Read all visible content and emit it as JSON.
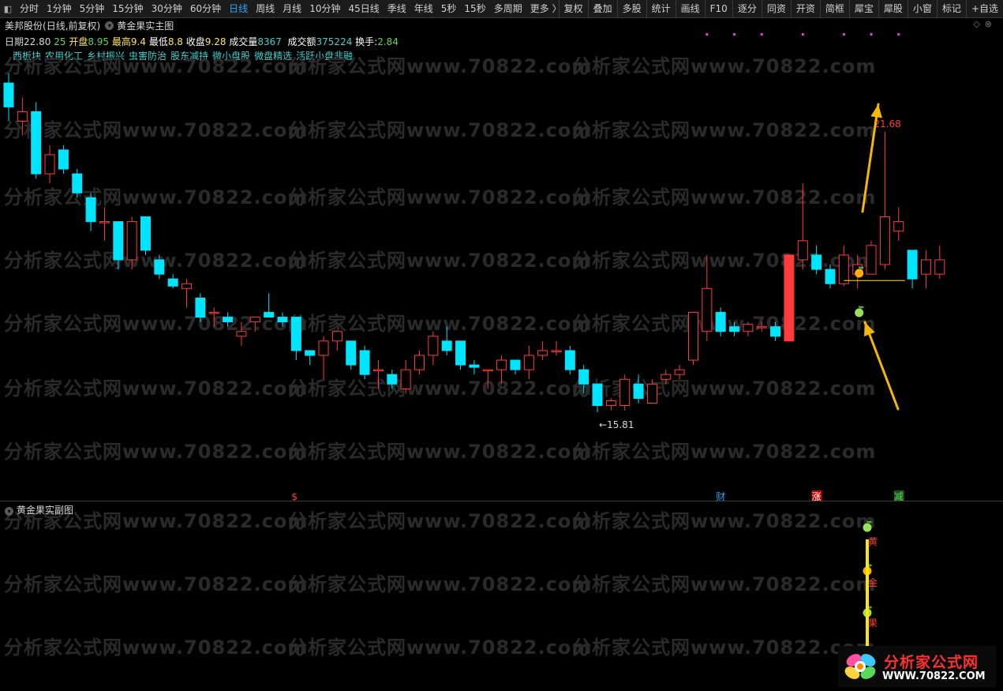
{
  "toolbar": {
    "periods": [
      "分时",
      "1分钟",
      "5分钟",
      "15分钟",
      "30分钟",
      "60分钟",
      "日线",
      "周线",
      "月线",
      "10分钟",
      "45日线",
      "季线",
      "年线",
      "5秒",
      "15秒",
      "多周期",
      "更多 〉"
    ],
    "active_period": "日线",
    "right_buttons": [
      "复权",
      "叠加",
      "多股",
      "统计",
      "画线",
      "F10",
      "逐分",
      "同资",
      "开资",
      "简框",
      "犀宝",
      "犀股",
      "小窗",
      "标记",
      "+自选"
    ]
  },
  "title_row": {
    "stock": "美邦股份",
    "mode": "(日线,前复权)",
    "indicator": "黄金果实主图"
  },
  "info_row": {
    "date_label": "日期",
    "date_value": "25",
    "open_label": "开盘",
    "open_value": "8.95",
    "high_label": "最高",
    "high_value": "9.4",
    "low_label": "最低",
    "low_value": "8.8",
    "close_label": "收盘",
    "close_value": "9.28",
    "vol_label": "成交量",
    "vol_value": "8367",
    "amount_label": "成交额",
    "amount_value": "375224",
    "turnover_label": "换手",
    "turnover_value": "2.84",
    "top_left_price": "22.80"
  },
  "concepts": [
    "西板块",
    "农用化工",
    "乡村振兴",
    "虫害防治",
    "股东减持",
    "微小盘股",
    "微盘精选",
    "活跃小盘非融"
  ],
  "sub_title": "黄金果实副图",
  "watermark": {
    "text": "分析家公式网www.70822.com"
  },
  "logo": {
    "title": "分析家公式网",
    "url": "WWW.70822.COM"
  },
  "colors": {
    "up": "#ff3b3b",
    "down": "#00e5ff",
    "arrow": "#f5b800",
    "yellow": "#ffe600",
    "bg": "#000000"
  },
  "chart_data": {
    "type": "candlestick",
    "y_axis": {
      "min": 15.0,
      "max": 23.0
    },
    "candles": [
      {
        "o": 22.7,
        "h": 22.9,
        "l": 21.9,
        "c": 22.2
      },
      {
        "o": 21.9,
        "h": 22.4,
        "l": 21.6,
        "c": 22.1
      },
      {
        "o": 22.1,
        "h": 22.3,
        "l": 20.7,
        "c": 20.8
      },
      {
        "o": 20.8,
        "h": 21.4,
        "l": 20.6,
        "c": 21.2
      },
      {
        "o": 21.3,
        "h": 21.4,
        "l": 20.8,
        "c": 20.9
      },
      {
        "o": 20.8,
        "h": 20.9,
        "l": 20.3,
        "c": 20.4
      },
      {
        "o": 20.3,
        "h": 20.4,
        "l": 19.6,
        "c": 19.8
      },
      {
        "o": 19.8,
        "h": 20.1,
        "l": 19.4,
        "c": 19.8
      },
      {
        "o": 19.8,
        "h": 19.8,
        "l": 18.8,
        "c": 19.0
      },
      {
        "o": 19.0,
        "h": 19.9,
        "l": 18.8,
        "c": 19.8
      },
      {
        "o": 19.9,
        "h": 19.9,
        "l": 19.1,
        "c": 19.2
      },
      {
        "o": 19.0,
        "h": 19.1,
        "l": 18.6,
        "c": 18.7
      },
      {
        "o": 18.6,
        "h": 18.7,
        "l": 18.4,
        "c": 18.45
      },
      {
        "o": 18.4,
        "h": 18.6,
        "l": 18.0,
        "c": 18.5
      },
      {
        "o": 18.2,
        "h": 18.3,
        "l": 17.7,
        "c": 17.8
      },
      {
        "o": 17.9,
        "h": 18.0,
        "l": 17.6,
        "c": 17.9
      },
      {
        "o": 17.8,
        "h": 17.9,
        "l": 17.6,
        "c": 17.7
      },
      {
        "o": 17.4,
        "h": 17.7,
        "l": 17.2,
        "c": 17.5
      },
      {
        "o": 17.7,
        "h": 17.8,
        "l": 17.5,
        "c": 17.8
      },
      {
        "o": 17.9,
        "h": 18.3,
        "l": 17.8,
        "c": 17.8
      },
      {
        "o": 17.8,
        "h": 17.9,
        "l": 17.6,
        "c": 17.7
      },
      {
        "o": 17.8,
        "h": 17.8,
        "l": 16.9,
        "c": 17.1
      },
      {
        "o": 17.1,
        "h": 17.1,
        "l": 16.8,
        "c": 17.0
      },
      {
        "o": 17.0,
        "h": 17.4,
        "l": 16.5,
        "c": 17.3
      },
      {
        "o": 17.3,
        "h": 17.5,
        "l": 17.1,
        "c": 17.5
      },
      {
        "o": 17.3,
        "h": 17.3,
        "l": 16.7,
        "c": 16.8
      },
      {
        "o": 17.1,
        "h": 17.2,
        "l": 16.5,
        "c": 16.6
      },
      {
        "o": 16.7,
        "h": 16.9,
        "l": 16.3,
        "c": 16.7
      },
      {
        "o": 16.6,
        "h": 16.7,
        "l": 16.3,
        "c": 16.4
      },
      {
        "o": 16.3,
        "h": 16.9,
        "l": 16.2,
        "c": 16.7
      },
      {
        "o": 16.7,
        "h": 17.1,
        "l": 16.6,
        "c": 17.0
      },
      {
        "o": 17.0,
        "h": 17.5,
        "l": 16.8,
        "c": 17.4
      },
      {
        "o": 17.3,
        "h": 17.6,
        "l": 17.0,
        "c": 17.1
      },
      {
        "o": 17.3,
        "h": 17.3,
        "l": 16.7,
        "c": 16.8
      },
      {
        "o": 16.8,
        "h": 16.9,
        "l": 16.6,
        "c": 16.75
      },
      {
        "o": 16.7,
        "h": 16.7,
        "l": 16.3,
        "c": 16.7
      },
      {
        "o": 16.7,
        "h": 17.0,
        "l": 16.4,
        "c": 16.9
      },
      {
        "o": 16.9,
        "h": 16.9,
        "l": 16.6,
        "c": 16.7
      },
      {
        "o": 16.7,
        "h": 17.2,
        "l": 16.5,
        "c": 17.0
      },
      {
        "o": 17.0,
        "h": 17.3,
        "l": 16.9,
        "c": 17.1
      },
      {
        "o": 17.1,
        "h": 17.3,
        "l": 17.0,
        "c": 17.1
      },
      {
        "o": 17.1,
        "h": 17.2,
        "l": 16.6,
        "c": 16.7
      },
      {
        "o": 16.7,
        "h": 16.8,
        "l": 16.2,
        "c": 16.4
      },
      {
        "o": 16.4,
        "h": 16.4,
        "l": 15.81,
        "c": 15.95
      },
      {
        "o": 15.95,
        "h": 16.1,
        "l": 15.85,
        "c": 16.05
      },
      {
        "o": 15.95,
        "h": 16.6,
        "l": 15.85,
        "c": 16.5
      },
      {
        "o": 16.4,
        "h": 16.6,
        "l": 16.0,
        "c": 16.1
      },
      {
        "o": 16.0,
        "h": 16.5,
        "l": 16.0,
        "c": 16.4
      },
      {
        "o": 16.5,
        "h": 16.7,
        "l": 16.4,
        "c": 16.6
      },
      {
        "o": 16.6,
        "h": 16.8,
        "l": 16.5,
        "c": 16.7
      },
      {
        "o": 16.9,
        "h": 17.9,
        "l": 16.8,
        "c": 17.9
      },
      {
        "o": 17.5,
        "h": 19.1,
        "l": 17.3,
        "c": 18.4
      },
      {
        "o": 17.9,
        "h": 18.0,
        "l": 17.4,
        "c": 17.5
      },
      {
        "o": 17.6,
        "h": 17.7,
        "l": 17.4,
        "c": 17.5
      },
      {
        "o": 17.5,
        "h": 17.7,
        "l": 17.4,
        "c": 17.65
      },
      {
        "o": 17.6,
        "h": 17.7,
        "l": 17.5,
        "c": 17.6
      },
      {
        "o": 17.6,
        "h": 17.7,
        "l": 17.3,
        "c": 17.4
      },
      {
        "o": 17.3,
        "h": 19.1,
        "l": 17.3,
        "c": 19.1
      },
      {
        "o": 19.0,
        "h": 20.6,
        "l": 18.8,
        "c": 19.4
      },
      {
        "o": 19.1,
        "h": 19.3,
        "l": 18.7,
        "c": 18.8
      },
      {
        "o": 18.8,
        "h": 18.9,
        "l": 18.4,
        "c": 18.5
      },
      {
        "o": 18.5,
        "h": 19.3,
        "l": 18.45,
        "c": 19.1
      },
      {
        "o": 18.7,
        "h": 19.1,
        "l": 18.4,
        "c": 18.9
      },
      {
        "o": 18.7,
        "h": 19.4,
        "l": 18.7,
        "c": 19.3
      },
      {
        "o": 18.9,
        "h": 21.68,
        "l": 18.8,
        "c": 19.9
      },
      {
        "o": 19.6,
        "h": 20.1,
        "l": 19.4,
        "c": 19.8
      },
      {
        "o": 19.2,
        "h": 19.2,
        "l": 18.4,
        "c": 18.6
      },
      {
        "o": 18.7,
        "h": 19.2,
        "l": 18.4,
        "c": 19.0
      },
      {
        "o": 18.7,
        "h": 19.3,
        "l": 18.6,
        "c": 19.0
      }
    ],
    "annotations": {
      "high_label": "21.68",
      "low_label": "←15.81"
    },
    "bottom_markers": [
      {
        "index": 21,
        "text": "$"
      },
      {
        "index": 52,
        "text": "财"
      },
      {
        "index": 59,
        "text": "涨"
      },
      {
        "index": 65,
        "text": "减"
      }
    ],
    "sub_chart_labels": [
      "黄",
      "金",
      "果"
    ]
  }
}
